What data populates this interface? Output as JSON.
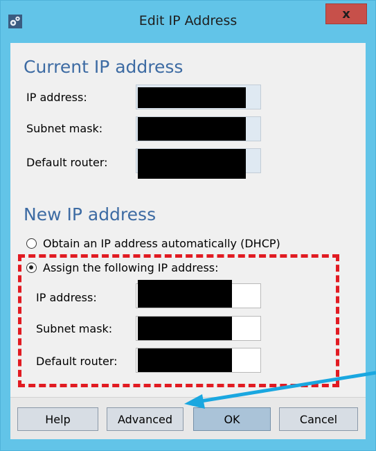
{
  "window": {
    "title": "Edit IP Address",
    "close_label": "x"
  },
  "current": {
    "heading": "Current IP address",
    "ip_label": "IP address:",
    "subnet_label": "Subnet mask:",
    "router_label": "Default router:"
  },
  "new": {
    "heading": "New IP address",
    "dhcp_label": "Obtain an IP address automatically (DHCP)",
    "assign_label": "Assign the following IP address:",
    "ip_label": "IP address:",
    "subnet_label": "Subnet mask:",
    "router_label": "Default router:",
    "selected": "assign"
  },
  "buttons": {
    "help": "Help",
    "advanced": "Advanced",
    "ok": "OK",
    "cancel": "Cancel"
  },
  "colors": {
    "titlebar": "#62c4e8",
    "section_heading": "#3d6ba3",
    "annotation_box": "#e11b22",
    "annotation_arrow": "#1aa7e0",
    "redaction": "#000000"
  }
}
